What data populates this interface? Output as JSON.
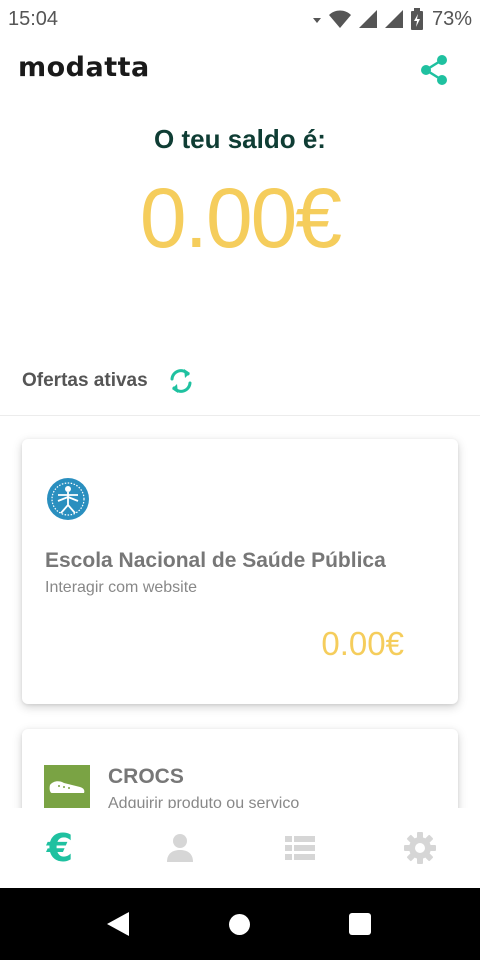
{
  "status_bar": {
    "time": "15:04",
    "battery": "73%"
  },
  "header": {
    "logo": "modatta",
    "share_icon": "share-icon"
  },
  "balance": {
    "label": "O teu saldo é:",
    "value": "0.00€"
  },
  "offers": {
    "title": "Ofertas ativas",
    "refresh_icon": "refresh-icon",
    "items": [
      {
        "title": "Escola Nacional de Saúde Pública",
        "subtitle": "Interagir com website",
        "amount": "0.00€",
        "logo": "ensp-logo"
      },
      {
        "title": "CROCS",
        "subtitle": "Adquirir produto ou serviço",
        "logo": "crocs-logo"
      }
    ]
  },
  "bottom_nav": {
    "items": [
      {
        "icon": "euro-icon",
        "label": "€",
        "active": true
      },
      {
        "icon": "profile-icon",
        "active": false
      },
      {
        "icon": "list-icon",
        "active": false
      },
      {
        "icon": "settings-icon",
        "active": false
      }
    ]
  },
  "colors": {
    "accent": "#1fc1a0",
    "balance": "#f5cd5c",
    "title_dark": "#0f3d34",
    "inactive_icon": "#d6d6d6"
  }
}
